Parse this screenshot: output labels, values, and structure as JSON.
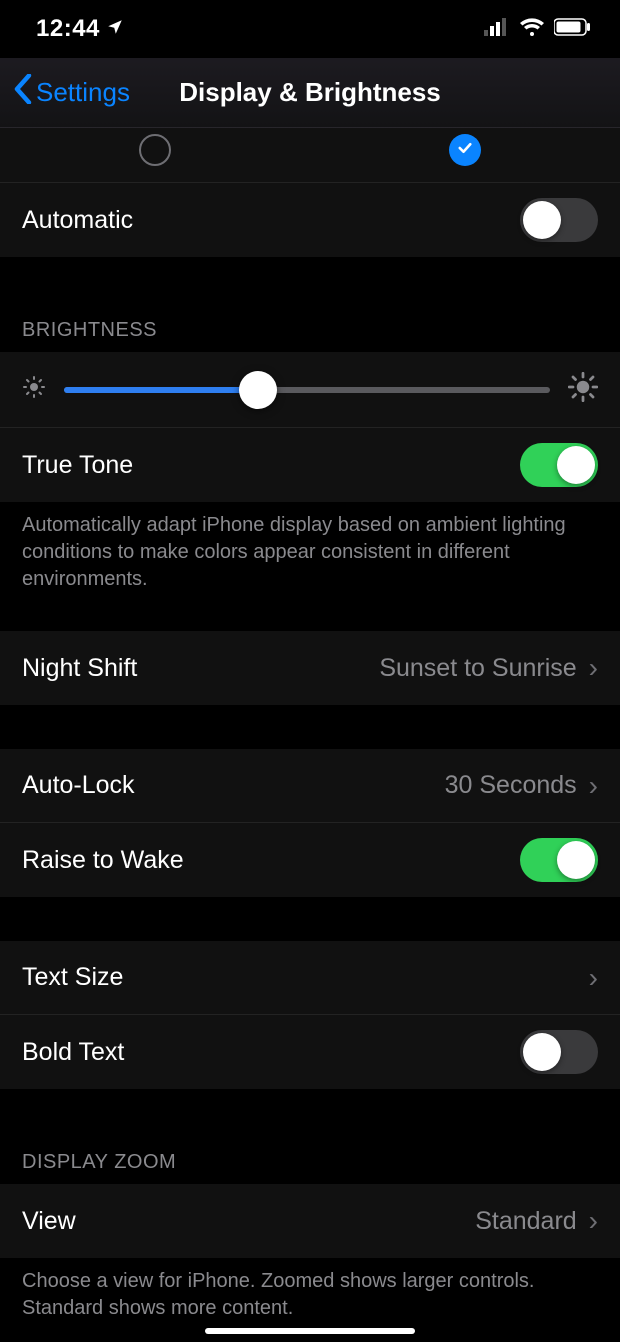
{
  "status": {
    "time": "12:44"
  },
  "nav": {
    "back_label": "Settings",
    "title": "Display & Brightness"
  },
  "appearance": {
    "automatic_label": "Automatic",
    "automatic_on": false
  },
  "brightness": {
    "header": "BRIGHTNESS",
    "value_pct": 40,
    "true_tone_label": "True Tone",
    "true_tone_on": true,
    "true_tone_footer": "Automatically adapt iPhone display based on ambient lighting conditions to make colors appear consistent in different environments."
  },
  "night_shift": {
    "label": "Night Shift",
    "value": "Sunset to Sunrise"
  },
  "auto_lock": {
    "label": "Auto-Lock",
    "value": "30 Seconds"
  },
  "raise_to_wake": {
    "label": "Raise to Wake",
    "on": true
  },
  "text_size": {
    "label": "Text Size"
  },
  "bold_text": {
    "label": "Bold Text",
    "on": false
  },
  "display_zoom": {
    "header": "DISPLAY ZOOM",
    "view_label": "View",
    "view_value": "Standard",
    "footer": "Choose a view for iPhone. Zoomed shows larger controls. Standard shows more content."
  }
}
